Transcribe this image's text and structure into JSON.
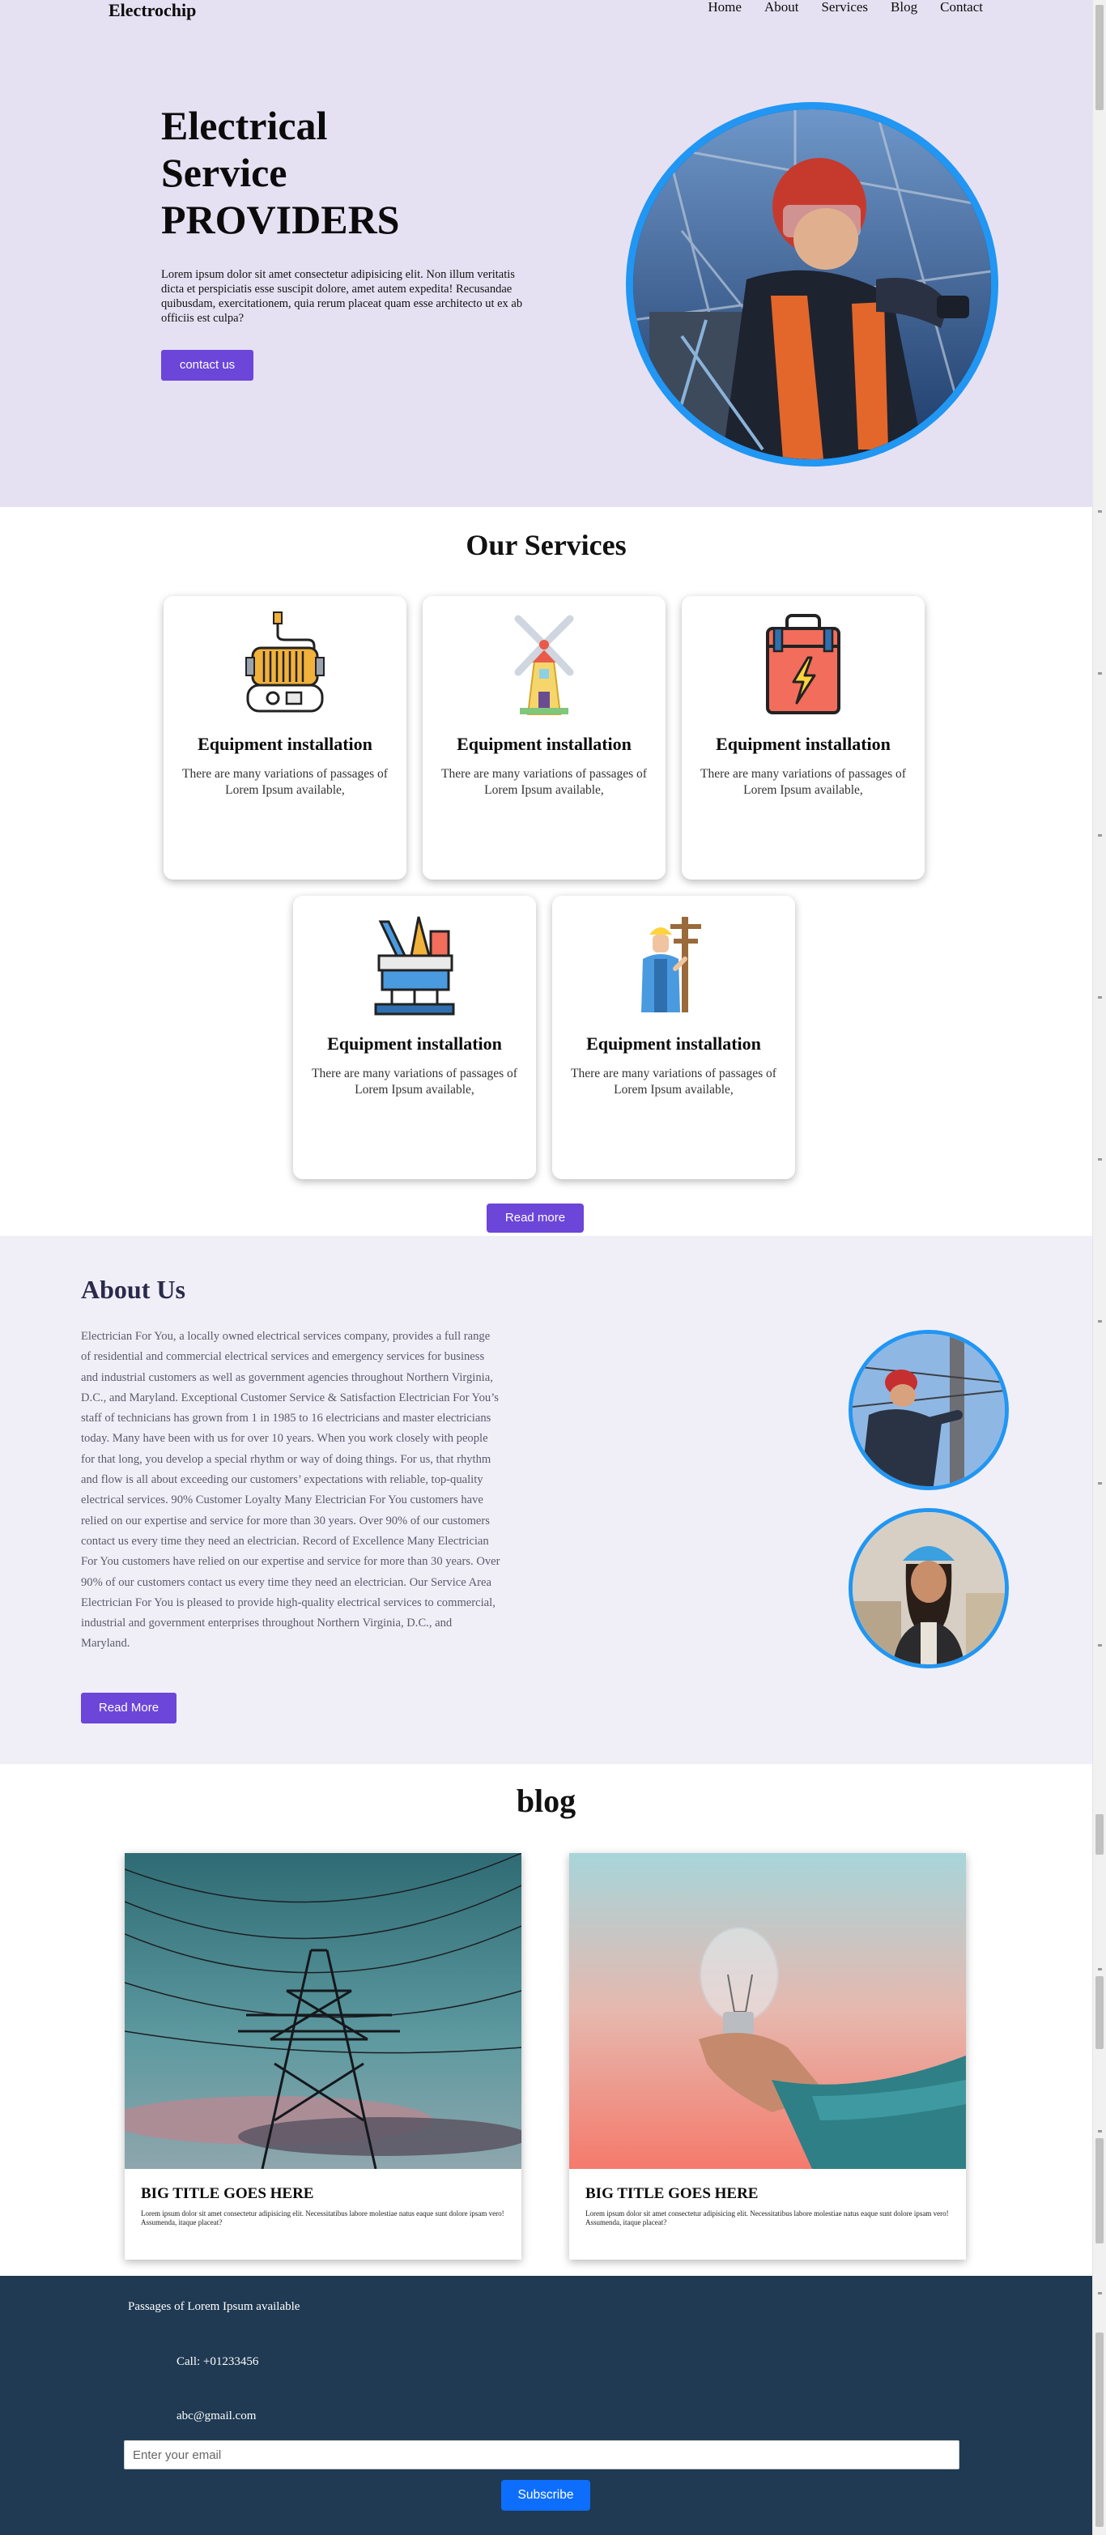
{
  "nav": {
    "brand": "Electrochip",
    "items": [
      "Home",
      "About",
      "Services",
      "Blog",
      "Contact"
    ]
  },
  "hero": {
    "title_line1": "Electrical",
    "title_line2": "Service",
    "title_line3": "PROVIDERS",
    "text": "Lorem ipsum dolor sit amet consectetur adipisicing elit. Non illum veritatis dicta et perspiciatis esse suscipit dolore, amet autem expedita! Recusandae quibusdam, exercitationem, quia rerum placeat quam esse architecto ut ex ab officiis est culpa?",
    "button": "contact us"
  },
  "services": {
    "title": "Our Services",
    "cards": [
      {
        "title": "Equipment installation",
        "text": "There are many variations of passages of Lorem Ipsum available,",
        "icon": "generator-icon"
      },
      {
        "title": "Equipment installation",
        "text": "There are many variations of passages of Lorem Ipsum available,",
        "icon": "windmill-icon"
      },
      {
        "title": "Equipment installation",
        "text": "There are many variations of passages of Lorem Ipsum available,",
        "icon": "toolbox-icon"
      },
      {
        "title": "Equipment installation",
        "text": "There are many variations of passages of Lorem Ipsum available,",
        "icon": "oil-platform-icon"
      },
      {
        "title": "Equipment installation",
        "text": "There are many variations of passages of Lorem Ipsum available,",
        "icon": "electrician-icon"
      }
    ],
    "button": "Read more"
  },
  "about": {
    "title": "About Us",
    "text": "Electrician For You, a locally owned electrical services company, provides a full range of residential and commercial electrical services and emergency services for business and industrial customers as well as government agencies throughout Northern Virginia, D.C., and Maryland. Exceptional Customer Service & Satisfaction Electrician For You’s staff of technicians has grown from 1 in 1985 to 16 electricians and master electricians today. Many have been with us for over 10 years. When you work closely with people for that long, you develop a special rhythm or way of doing things. For us, that rhythm and flow is all about exceeding our customers’ expectations with reliable, top-quality electrical services. 90% Customer Loyalty Many Electrician For You customers have relied on our expertise and service for more than 30 years. Over 90% of our customers contact us every time they need an electrician. Record of Excellence Many Electrician For You customers have relied on our expertise and service for more than 30 years. Over 90% of our customers contact us every time they need an electrician. Our Service Area Electrician For You is pleased to provide high-quality electrical services to commercial, industrial and government enterprises throughout Northern Virginia, D.C., and Maryland.",
    "button": "Read More"
  },
  "blog": {
    "title": "blog",
    "posts": [
      {
        "title": "BIG TITLE GOES HERE",
        "text": "Lorem ipsum dolor sit amet consectetur adipisicing elit. Necessitatibus labore molestiae natus eaque sunt dolore ipsam vero! Assumenda, itaque placeat?"
      },
      {
        "title": "BIG TITLE GOES HERE",
        "text": "Lorem ipsum dolor sit amet consectetur adipisicing elit. Necessitatibus labore molestiae natus eaque sunt dolore ipsam vero! Assumenda, itaque placeat?"
      }
    ]
  },
  "footer": {
    "tagline": "Passages of Lorem Ipsum available",
    "phone": "Call: +01233456",
    "email": "abc@gmail.com",
    "email_placeholder": "Enter your email",
    "subscribe": "Subscribe"
  },
  "colors": {
    "hero_bg": "#e6e1f2",
    "accent_purple": "#6c45d9",
    "ring_blue": "#2196f3",
    "about_bg": "#f0eff8",
    "footer_bg": "#1f3a52",
    "subscribe_blue": "#0d6efd"
  }
}
